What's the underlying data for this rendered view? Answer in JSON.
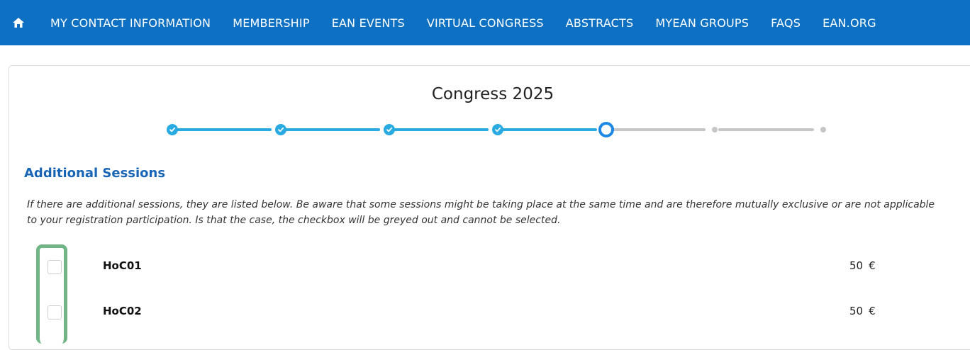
{
  "nav": {
    "items": [
      {
        "label": "MY CONTACT INFORMATION"
      },
      {
        "label": "MEMBERSHIP"
      },
      {
        "label": "EAN EVENTS"
      },
      {
        "label": "VIRTUAL CONGRESS"
      },
      {
        "label": "ABSTRACTS"
      },
      {
        "label": "MYEAN GROUPS"
      },
      {
        "label": "FAQS"
      },
      {
        "label": "EAN.ORG"
      }
    ],
    "home_icon": "home-icon"
  },
  "page": {
    "title": "Congress 2025"
  },
  "stepper": {
    "steps": [
      "done",
      "done",
      "done",
      "done",
      "current",
      "todo",
      "todo"
    ],
    "accent_color": "#29aae1",
    "inactive_color": "#c6c6c6"
  },
  "additional_sessions": {
    "heading": "Additional Sessions",
    "notice": "If there are additional sessions, they are listed below. Be aware that some sessions might be taking place at the same time and are therefore mutually exclusive or are not applicable to your registration participation. Is that the case, the checkbox will be greyed out and cannot be selected.",
    "sessions": [
      {
        "name": "HoC01",
        "price": "50",
        "currency": "€",
        "checked": false
      },
      {
        "name": "HoC02",
        "price": "50",
        "currency": "€",
        "checked": false
      }
    ]
  },
  "colors": {
    "nav_bg": "#0d70c3",
    "heading": "#1765b4",
    "highlight": "#6fb586"
  }
}
